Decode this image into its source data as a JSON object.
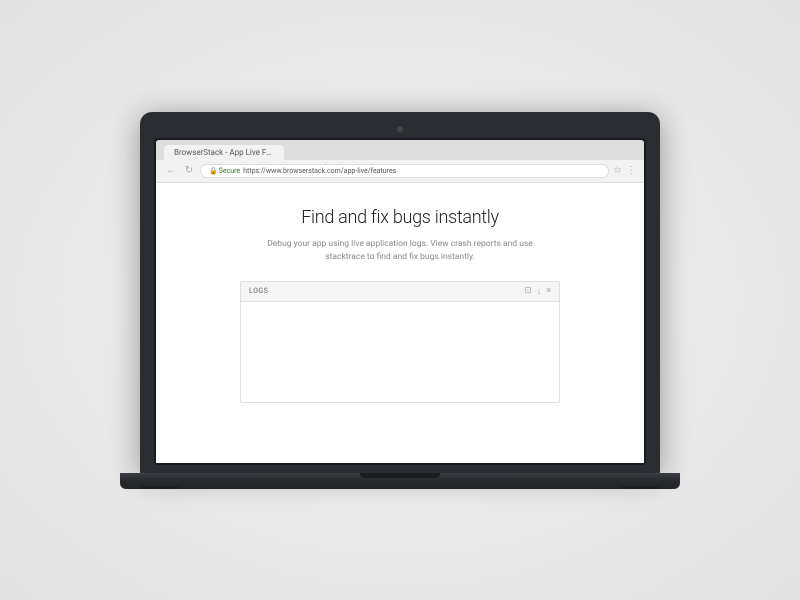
{
  "browser": {
    "tab_label": "BrowserStack - App Live Features",
    "nav": {
      "back_icon": "←",
      "refresh_icon": "↻",
      "secure_label": "Secure",
      "url_prefix": "https://",
      "url_domain": "www.browserstack.com",
      "url_path": "/app-live/features",
      "star_icon": "☆",
      "menu_icon": "⋮"
    }
  },
  "page": {
    "headline": "Find and fix bugs instantly",
    "subtext": "Debug your app using live application logs. View crash reports and use stacktrace to find and fix bugs instantly.",
    "logs_panel": {
      "label": "LOGS",
      "action_resize": "⊡",
      "action_download": "↓",
      "action_close": "×"
    }
  }
}
